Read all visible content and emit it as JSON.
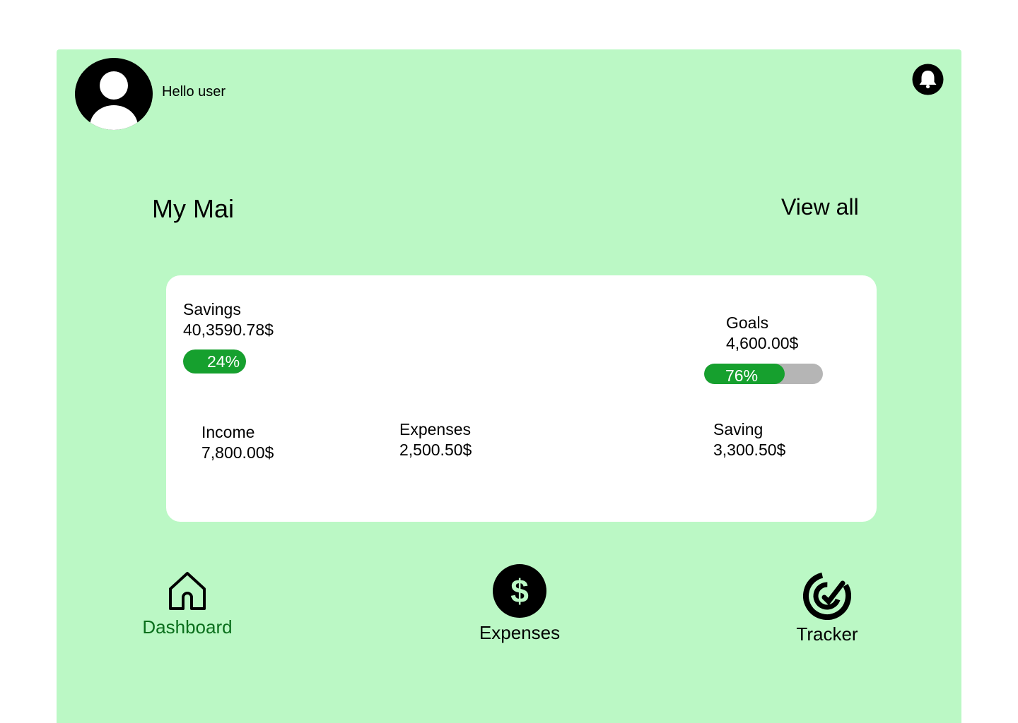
{
  "header": {
    "greeting": "Hello user",
    "avatar_icon": "user-avatar-icon",
    "notification_icon": "bell-icon"
  },
  "section": {
    "title": "My Mai",
    "view_all": "View all"
  },
  "card": {
    "savings": {
      "label": "Savings",
      "value": "40,3590.78$",
      "progress_label": "24%",
      "progress": 0.24
    },
    "goals": {
      "label": "Goals",
      "value": "4,600.00$",
      "progress_label": "76%",
      "progress": 0.76
    },
    "income": {
      "label": "Income",
      "value": "7,800.00$"
    },
    "expenses": {
      "label": "Expenses",
      "value": "2,500.50$"
    },
    "saving": {
      "label": "Saving",
      "value": "3,300.50$"
    }
  },
  "nav": {
    "dashboard": "Dashboard",
    "expenses": "Expenses",
    "tracker": "Tracker"
  },
  "colors": {
    "background": "#bbf8c5",
    "progress_fill": "#16a02e",
    "progress_track": "#b5b5b5",
    "active_nav": "#0a6f1c"
  }
}
